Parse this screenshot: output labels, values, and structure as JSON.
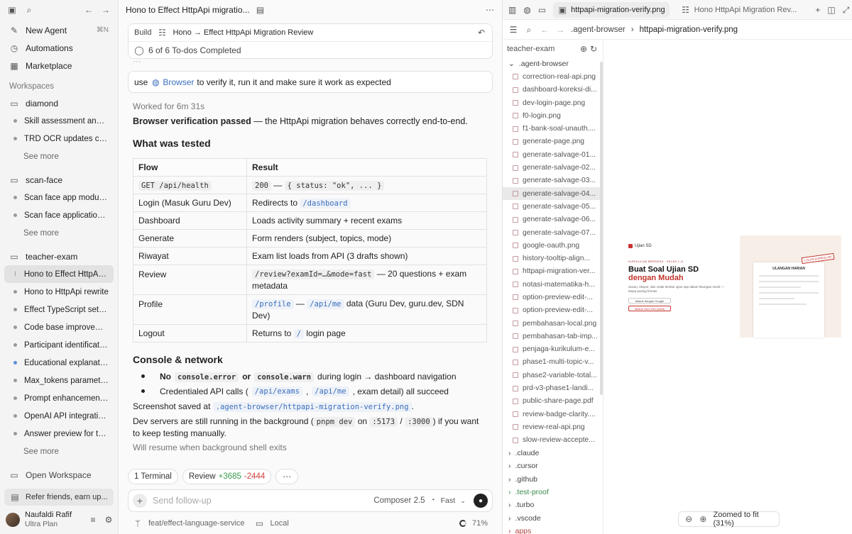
{
  "sidebar": {
    "nav": [
      {
        "label": "New Agent",
        "shortcut": "⌘N"
      },
      {
        "label": "Automations"
      },
      {
        "label": "Marketplace"
      }
    ],
    "workspaces_label": "Workspaces",
    "projects": [
      {
        "name": "diamond",
        "items": [
          "Skill assessment and ...",
          "TRD OCR updates co..."
        ],
        "see_more": "See more"
      },
      {
        "name": "scan-face",
        "items": [
          "Scan face app modula...",
          "Scan face application i..."
        ],
        "see_more": "See more"
      },
      {
        "name": "teacher-exam",
        "items": [
          "Hono to Effect HttpApi...",
          "Hono to HttpApi rewrite",
          "Effect TypeScript setu...",
          "Code base improveme...",
          "Participant identification",
          "Educational explanatio...",
          "Max_tokens paramete...",
          "Prompt enhancement ...",
          "OpenAI API integration...",
          "Answer preview for te..."
        ],
        "see_more": "See more"
      }
    ],
    "open_workspace": "Open Workspace",
    "refer": "Refer friends, earn up...",
    "user": {
      "name": "Naufaldi Rafif",
      "plan": "Ultra Plan"
    }
  },
  "chat": {
    "title": "Hono to Effect HttpApi migratio...",
    "build_label": "Build",
    "build_title": "Hono → Effect HttpApi Migration Review",
    "todos": "6 of 6 To-dos Completed",
    "prompt_pre": "use",
    "prompt_link": "Browser",
    "prompt_post": "to verify it, run it and make sure it work as expected",
    "worked": "Worked for 6m 31s",
    "verif_bold": "Browser verification passed",
    "verif_rest": " — the HttpApi migration behaves correctly end-to-end.",
    "h_tested": "What was tested",
    "table_headers": [
      "Flow",
      "Result"
    ],
    "rows": [
      {
        "flow": "GET /api/health",
        "result_code": "200",
        "result_text": " — ",
        "result_code2": "{ status: \"ok\", ... }"
      },
      {
        "flow": "Login (Masuk Guru Dev)",
        "result_text": "Redirects to ",
        "result_code": "/dashboard"
      },
      {
        "flow": "Dashboard",
        "result_text": "Loads activity summary + recent exams"
      },
      {
        "flow": "Generate",
        "result_text": "Form renders (subject, topics, mode)"
      },
      {
        "flow": "Riwayat",
        "result_text": "Exam list loads from API (3 drafts shown)"
      },
      {
        "flow": "Review",
        "result_code": "/review?examId=…&mode=fast",
        "result_text": " — 20 questions + exam metadata"
      },
      {
        "flow": "Profile",
        "result_code": "/profile",
        "result_mid": " — ",
        "result_code2": "/api/me",
        "result_text": " data (Guru Dev, guru.dev, SDN Dev)"
      },
      {
        "flow": "Logout",
        "result_text_pre": "Returns to ",
        "result_code": "/",
        "result_text": " login page"
      }
    ],
    "h_console": "Console & network",
    "bullet1": {
      "no": "No",
      "c1": "console.error",
      "or": "or",
      "c2": "console.warn",
      "rest": "during login → dashboard navigation"
    },
    "bullet2": {
      "pre": "Credentialed API calls (",
      "c1": "/api/exams",
      "sep": ",",
      "c2": "/api/me",
      "rest": ", exam detail) all succeed"
    },
    "screenshot_pre": "Screenshot saved at",
    "screenshot_path": ".agent-browser/httpapi-migration-verify.png",
    "dev_servers": {
      "pre": "Dev servers are still running in the background (",
      "cmd": "pnpm dev",
      "on": "on",
      "p1": ":5173",
      "slash": "/",
      "p2": ":3000",
      "post": ") if you want to keep testing manually."
    },
    "resume": "Will resume when background shell exits",
    "chips": {
      "terminal": "1 Terminal",
      "review": "Review",
      "add": "+3685",
      "del": "-2444"
    },
    "composer": {
      "placeholder": "Send follow-up",
      "model": "Composer 2.5",
      "speed": "Fast"
    },
    "footer": {
      "branch": "feat/effect-language-service",
      "env": "Local",
      "pct": "71%"
    }
  },
  "right": {
    "tabs": [
      "httpapi-migration-verify.png",
      "Hono HttpApi Migration Rev..."
    ],
    "path": [
      ".agent-browser",
      "httpapi-migration-verify.png"
    ],
    "tree_root": "teacher-exam",
    "folder_open": ".agent-browser",
    "files": [
      "correction-real-api.png",
      "dashboard-koreksi-di...",
      "dev-login-page.png",
      "f0-login.png",
      "f1-bank-soal-unauth....",
      "generate-page.png",
      "generate-salvage-01...",
      "generate-salvage-02...",
      "generate-salvage-03...",
      "generate-salvage-04...",
      "generate-salvage-05...",
      "generate-salvage-06...",
      "generate-salvage-07...",
      "google-oauth.png",
      "history-tooltip-align...",
      "httpapi-migration-ver...",
      "notasi-matematika-h...",
      "option-preview-edit-...",
      "option-preview-edit-...",
      "pembahasan-local.png",
      "pembahasan-tab-imp...",
      "penjaga-kurikulum-e...",
      "phase1-multi-topic-v...",
      "phase2-variable-total...",
      "prd-v3-phase1-landi...",
      "public-share-page.pdf",
      "review-badge-clarity....",
      "review-real-api.png",
      "slow-review-accepte..."
    ],
    "folders": [
      ".claude",
      ".cursor",
      ".github",
      ".test-proof",
      ".turbo",
      ".vscode",
      "apps"
    ],
    "preview": {
      "brand": "Ujian SD",
      "kicker": "KURIKULUM MERDEKA · KELAS 1–6",
      "title1": "Buat Soal Ujian SD",
      "title2": "dengan Mudah",
      "desc": "Susun, ekspor, dan cetak lembar ujian rapi dalam hitungan menit — tanpa pusing format.",
      "btn1": "Masuk dengan Google",
      "btn2": "Masuk Guru Dev (lokal)",
      "paper_title": "ULANGAN HARIAN",
      "stamp": "LOLOS KURIKULUM"
    },
    "zoom": "Zoomed to fit (31%)"
  }
}
